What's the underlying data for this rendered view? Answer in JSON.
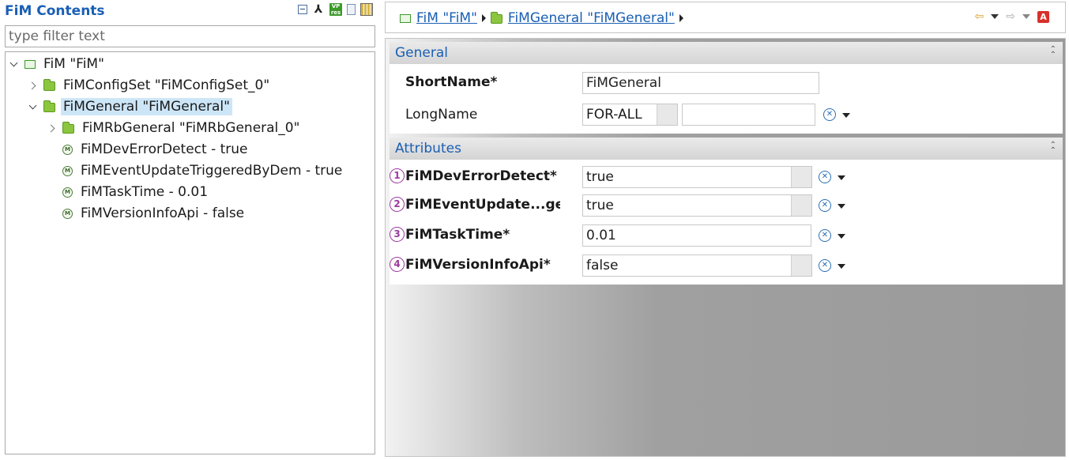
{
  "left_panel": {
    "title": "FiM Contents",
    "filter_placeholder": "type filter text",
    "header_icons": [
      "collapse-all-icon",
      "link-icon",
      "vp-res-icon",
      "document-icon",
      "grid-icon"
    ],
    "tree": [
      {
        "label": "FiM \"FiM\"",
        "icon": "module-icon",
        "expanded": true
      },
      {
        "label": "FiMConfigSet \"FiMConfigSet_0\"",
        "icon": "folder-icon",
        "expanded": false
      },
      {
        "label": "FiMGeneral \"FiMGeneral\"",
        "icon": "folder-icon",
        "expanded": true,
        "selected": true
      },
      {
        "label": "FiMRbGeneral \"FiMRbGeneral_0\"",
        "icon": "folder-icon",
        "expanded": false
      },
      {
        "label": "FiMDevErrorDetect - true",
        "icon": "parameter-icon"
      },
      {
        "label": "FiMEventUpdateTriggeredByDem - true",
        "icon": "parameter-icon"
      },
      {
        "label": "FiMTaskTime - 0.01",
        "icon": "parameter-icon"
      },
      {
        "label": "FiMVersionInfoApi - false",
        "icon": "parameter-icon"
      }
    ]
  },
  "breadcrumb": {
    "items": [
      "FiM \"FiM\"",
      "FiMGeneral \"FiMGeneral\""
    ]
  },
  "general_section": {
    "title": "General",
    "short_name_label": "ShortName*",
    "short_name_value": "FiMGeneral",
    "long_name_label": "LongName",
    "long_name_lang": "FOR-ALL",
    "long_name_value": ""
  },
  "attributes_section": {
    "title": "Attributes",
    "fields": [
      {
        "badge": "1",
        "label": "FiMDevErrorDetect*",
        "value": "true",
        "kind": "combo"
      },
      {
        "badge": "2",
        "label": "FiMEventUpdate...gere",
        "value": "true",
        "kind": "combo"
      },
      {
        "badge": "3",
        "label": "FiMTaskTime*",
        "value": "0.01",
        "kind": "text"
      },
      {
        "badge": "4",
        "label": "FiMVersionInfoApi*",
        "value": "false",
        "kind": "combo"
      }
    ]
  },
  "colors": {
    "accent": "#1a5fb4",
    "selection": "#cde6f7",
    "badge": "#9b3aa0"
  }
}
